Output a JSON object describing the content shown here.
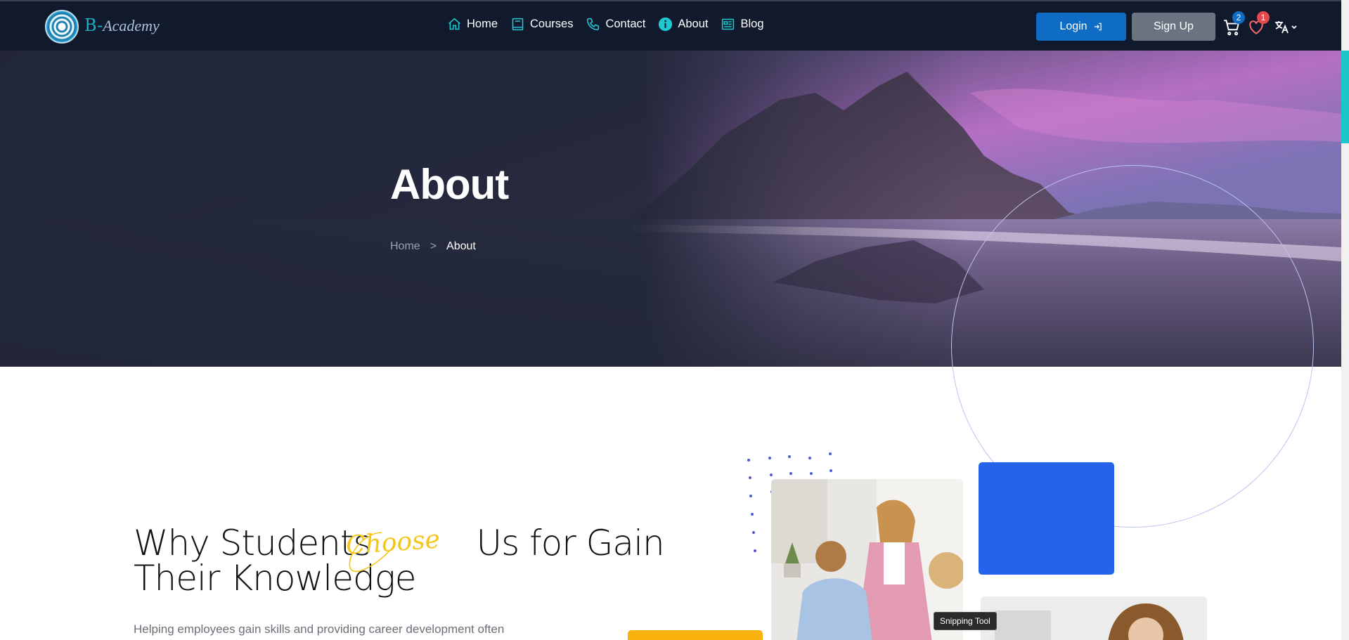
{
  "brand": {
    "prefix": "B-",
    "name": "Academy"
  },
  "nav": {
    "items": [
      {
        "label": "Home",
        "icon": "home-icon"
      },
      {
        "label": "Courses",
        "icon": "book-icon"
      },
      {
        "label": "Contact",
        "icon": "phone-icon"
      },
      {
        "label": "About",
        "icon": "info-icon"
      },
      {
        "label": "Blog",
        "icon": "newspaper-icon"
      }
    ],
    "login_label": "Login",
    "signup_label": "Sign Up",
    "cart_count": "2",
    "wishlist_count": "1",
    "accent_color": "#19b2c6"
  },
  "hero": {
    "title": "About",
    "breadcrumb": {
      "home": "Home",
      "separator": ">",
      "current": "About"
    }
  },
  "why": {
    "title_part1": "Why Students",
    "title_accent": "Choose",
    "title_part2": "Us for Gain",
    "title_line2": "Their Knowledge",
    "description": "Helping employees gain skills and providing career development often"
  },
  "tooltip": {
    "text": "Snipping Tool"
  },
  "colors": {
    "navbar": "#101a2c",
    "login_button": "#0f6cc4",
    "signup_button": "#6a7480",
    "accent_blue": "#2563eb",
    "accent_yellow": "#f9b10c",
    "script_yellow": "#f5c518"
  }
}
